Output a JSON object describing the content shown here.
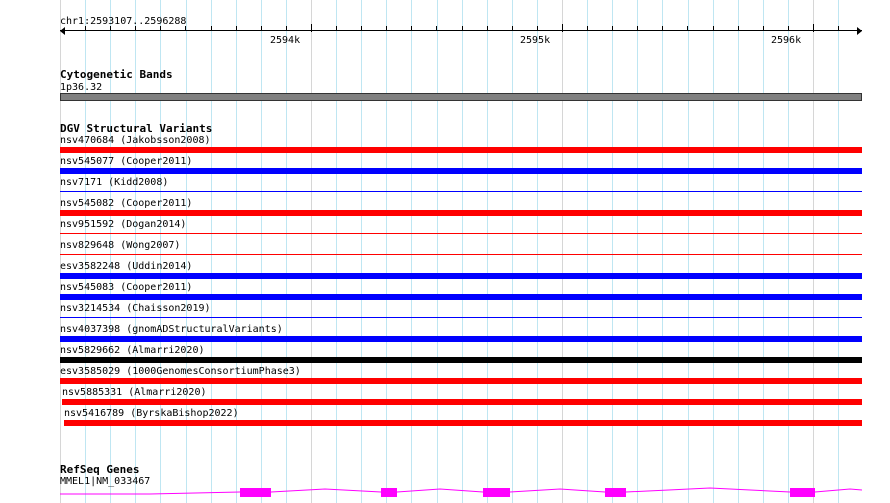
{
  "ruler": {
    "position_label": "chr1:2593107..2596288",
    "tick_labels": [
      "2594k",
      "2595k",
      "2596k"
    ]
  },
  "cytoband": {
    "title": "Cytogenetic Bands",
    "band_label": "1p36.32",
    "band_color": "#808080"
  },
  "dgv": {
    "title": "DGV Structural Variants",
    "items": [
      {
        "label": "nsv470684 (Jakobsson2008)",
        "color": "#ff0000",
        "style": "bar"
      },
      {
        "label": "nsv545077 (Cooper2011)",
        "color": "#0000ff",
        "style": "bar"
      },
      {
        "label": "nsv7171 (Kidd2008)",
        "color": "#0000ff",
        "style": "thin"
      },
      {
        "label": "nsv545082 (Cooper2011)",
        "color": "#ff0000",
        "style": "bar"
      },
      {
        "label": "nsv951592 (Dogan2014)",
        "color": "#ff0000",
        "style": "thin"
      },
      {
        "label": "nsv829648 (Wong2007)",
        "color": "#ff0000",
        "style": "thin"
      },
      {
        "label": "esv3582248 (Uddin2014)",
        "color": "#0000ff",
        "style": "bar"
      },
      {
        "label": "nsv545083 (Cooper2011)",
        "color": "#0000ff",
        "style": "bar"
      },
      {
        "label": "nsv3214534 (Chaisson2019)",
        "color": "#0000ff",
        "style": "thin"
      },
      {
        "label": "nsv4037398 (gnomADStructuralVariants)",
        "color": "#0000ff",
        "style": "bar"
      },
      {
        "label": "nsv5829662 (Almarri2020)",
        "color": "#000000",
        "style": "bar"
      },
      {
        "label": "esv3585029 (1000GenomesConsortiumPhase3)",
        "color": "#ff0000",
        "style": "bar"
      },
      {
        "label": "nsv5885331 (Almarri2020)",
        "color": "#ff0000",
        "style": "bar"
      },
      {
        "label": "nsv5416789 (ByrskaBishop2022)",
        "color": "#ff0000",
        "style": "bar"
      }
    ]
  },
  "refseq": {
    "title": "RefSeq Genes",
    "gene_label": "MMEL1|NM_033467",
    "color": "#ff00ff"
  },
  "colors": {
    "grid_minor": "#bfe6f2",
    "grid_major": "#d6d6d6",
    "variant_gain": "#0000ff",
    "variant_loss": "#ff0000",
    "variant_complex": "#000000"
  }
}
